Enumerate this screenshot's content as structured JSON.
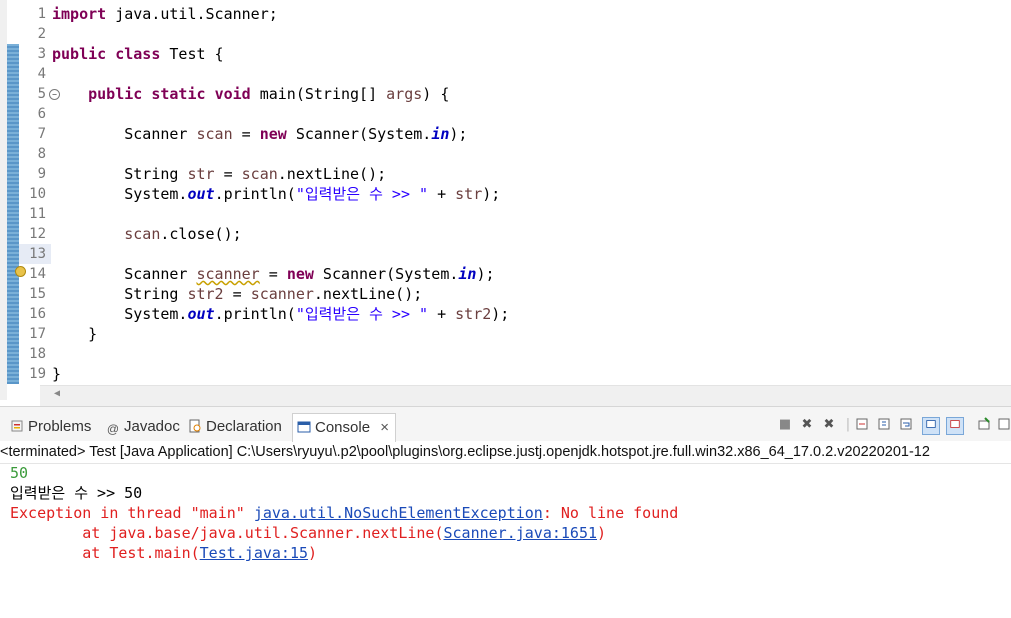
{
  "editor": {
    "lines": [
      {
        "n": "1"
      },
      {
        "n": "2"
      },
      {
        "n": "3"
      },
      {
        "n": "4"
      },
      {
        "n": "5"
      },
      {
        "n": "6"
      },
      {
        "n": "7"
      },
      {
        "n": "8"
      },
      {
        "n": "9"
      },
      {
        "n": "10"
      },
      {
        "n": "11"
      },
      {
        "n": "12"
      },
      {
        "n": "13"
      },
      {
        "n": "14"
      },
      {
        "n": "15"
      },
      {
        "n": "16"
      },
      {
        "n": "17"
      },
      {
        "n": "18"
      },
      {
        "n": "19"
      }
    ],
    "tokens": {
      "l1_kw": "import",
      "l1_rest": " java.util.Scanner;",
      "l3_kw1": "public",
      "l3_kw2": "class",
      "l3_rest": " Test {",
      "l5_kw1": "public",
      "l5_kw2": "static",
      "l5_kw3": "void",
      "l5_rest": " main(String[] ",
      "l5_var": "args",
      "l5_end": ") {",
      "l7_a": "Scanner ",
      "l7_var": "scan",
      "l7_b": " = ",
      "l7_kw": "new",
      "l7_c": " Scanner(System.",
      "l7_fld": "in",
      "l7_d": ");",
      "l9_a": "String ",
      "l9_var": "str",
      "l9_b": " = ",
      "l9_var2": "scan",
      "l9_c": ".nextLine();",
      "l10_a": "System.",
      "l10_fld": "out",
      "l10_b": ".println(",
      "l10_str": "\"입력받은 수 >> \"",
      "l10_c": " + ",
      "l10_var": "str",
      "l10_d": ");",
      "l12_var": "scan",
      "l12_a": ".close();",
      "l14_a": "Scanner ",
      "l14_var": "scanner",
      "l14_b": " = ",
      "l14_kw": "new",
      "l14_c": " Scanner(System.",
      "l14_fld": "in",
      "l14_d": ");",
      "l15_a": "String ",
      "l15_var": "str2",
      "l15_b": " = ",
      "l15_var2": "scanner",
      "l15_c": ".nextLine();",
      "l16_a": "System.",
      "l16_fld": "out",
      "l16_b": ".println(",
      "l16_str": "\"입력받은 수 >> \"",
      "l16_c": " + ",
      "l16_var": "str2",
      "l16_d": ");",
      "l17": "}",
      "l19": "}"
    }
  },
  "tabs": {
    "problems": "Problems",
    "javadoc": "Javadoc",
    "declaration": "Declaration",
    "console": "Console",
    "console_close": "×"
  },
  "toolbar": {
    "terminate": "■",
    "remove": "✖",
    "remove_all": "✖",
    "sep": "|"
  },
  "status_line": "<terminated> Test [Java Application] C:\\Users\\ryuyu\\.p2\\pool\\plugins\\org.eclipse.justj.openjdk.hotspot.jre.full.win32.x86_64_17.0.2.v20220201-12",
  "console": {
    "input": "50",
    "out1": "입력받은 수 >> 50",
    "exc_a": "Exception in thread \"main\" ",
    "exc_link": "java.util.NoSuchElementException",
    "exc_b": ": No line found",
    "at1_a": "        at java.base/java.util.Scanner.nextLine(",
    "at1_link": "Scanner.java:1651",
    "at1_b": ")",
    "at2_a": "        at Test.main(",
    "at2_link": "Test.java:15",
    "at2_b": ")"
  },
  "colors": {
    "keyword": "#7f0055",
    "string": "#2a00ff",
    "field": "#0000c0",
    "error": "#e02020",
    "link": "#1a4ab8",
    "input": "#3a9a3a"
  }
}
